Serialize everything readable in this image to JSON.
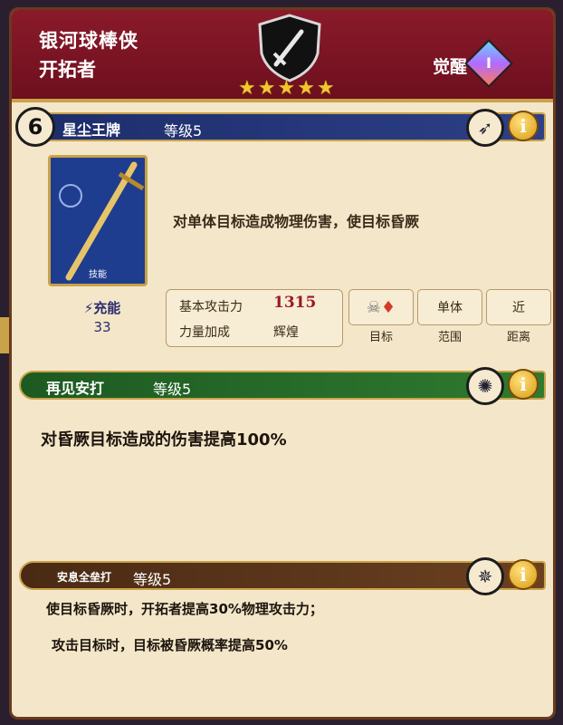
{
  "header": {
    "hero_name": "银河球棒侠",
    "hero_class": "开拓者",
    "awaken_label": "觉醒",
    "awaken_level": "I",
    "stars": 5
  },
  "skill_active": {
    "index": "6",
    "title": "星尘王牌",
    "level": "等级5",
    "card_label": "技能",
    "description": "对单体目标造成物理伤害，使目标昏厥",
    "charge_label": "充能",
    "charge_value": "33",
    "stats": {
      "attack_label": "基本攻击力",
      "attack_value": "1315",
      "bonus_label": "力量加成",
      "bonus_value": "辉煌"
    },
    "tags": {
      "target_label": "目标",
      "range_value": "单体",
      "range_label": "范围",
      "distance_value": "近",
      "distance_label": "距离"
    }
  },
  "skill_passive1": {
    "title": "再见安打",
    "level": "等级5",
    "description": "对昏厥目标造成的伤害提高100%"
  },
  "skill_passive2": {
    "title": "安息全垒打",
    "level": "等级5",
    "line1": "使目标昏厥时，开拓者提高30%物理攻击力；",
    "line2": "攻击目标时，目标被昏厥概率提高50%"
  },
  "colors": {
    "header_red": "#7a1424",
    "gold": "#c9a24a",
    "parchment": "#f3e6c9",
    "blue_bar": "#1d2d6b",
    "green_bar": "#1d5a22",
    "brown_bar": "#4a2a14"
  },
  "icons": {
    "class_emblem": "sword-shield-icon",
    "active_skill": "bow-arrow-icon",
    "passive1": "swirl-icon",
    "passive2": "sparkle-icon",
    "info": "info-icon"
  }
}
